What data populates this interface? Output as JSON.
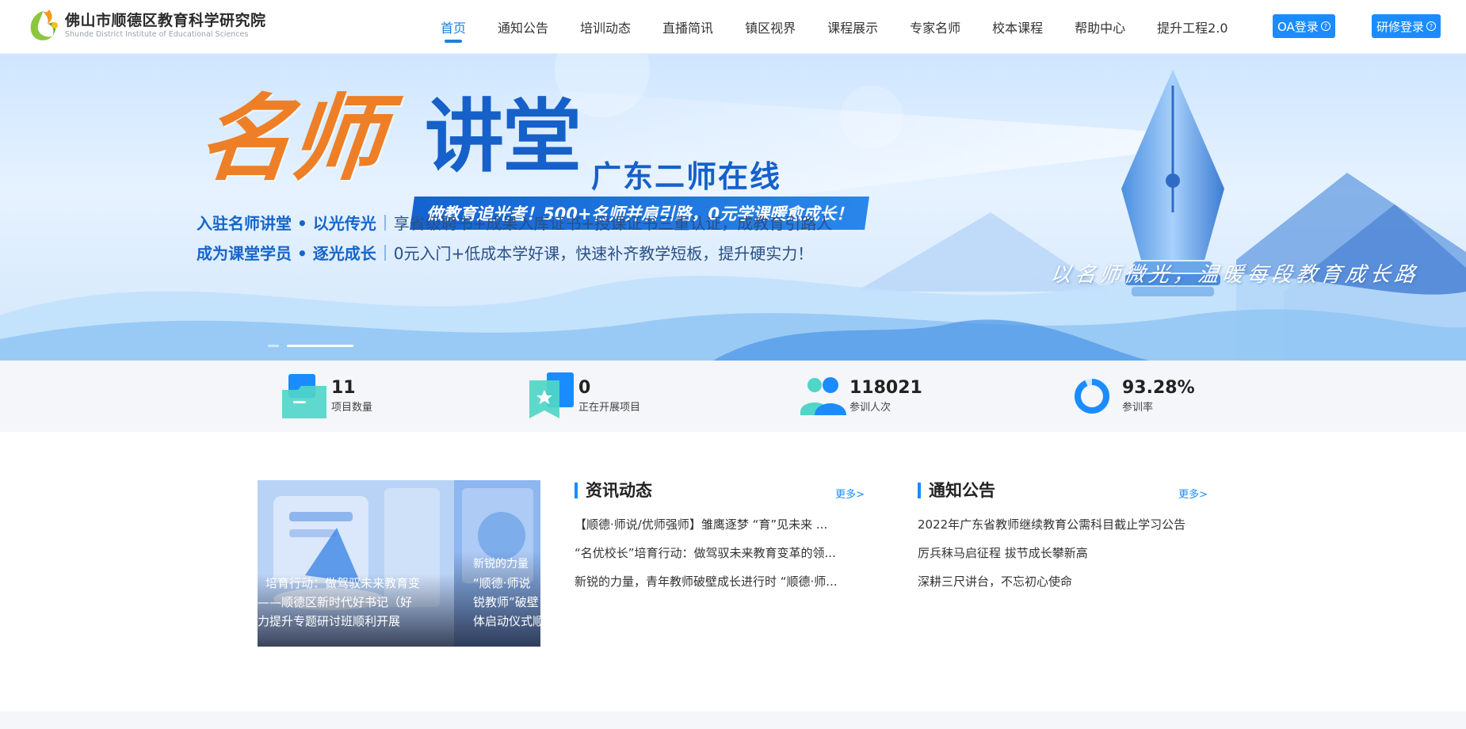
{
  "header": {
    "logo_cn": "佛山市顺德区教育科学研究院",
    "logo_en": "Shunde District Institute of Educational Sciences",
    "nav": [
      {
        "label": "首页",
        "active": true
      },
      {
        "label": "通知公告"
      },
      {
        "label": "培训动态"
      },
      {
        "label": "直播简讯"
      },
      {
        "label": "镇区视界"
      },
      {
        "label": "课程展示"
      },
      {
        "label": "专家名师"
      },
      {
        "label": "校本课程"
      },
      {
        "label": "帮助中心"
      },
      {
        "label": "提升工程2.0"
      }
    ],
    "oa_login": "OA登录",
    "study_login": "研修登录",
    "help_glyph": "?"
  },
  "banner": {
    "title_orange": "名师",
    "title_blue": "讲堂",
    "subtitle": "广东二师在线",
    "ribbon": "做教育追光者！500+名师并肩引路，0元学课暖愈成长！",
    "line1_key": "入驻名师讲堂 • 以光传光",
    "line1_value": "享省级聘书+成果入库证书+授课证书三重认证，成教育引路人",
    "line2_key": "成为课堂学员 • 逐光成长",
    "line2_value": "0元入门+低成本学好课，快速补齐教学短板，提升硬实力！",
    "slogan": "以名师微光，温暖每段教育成长路"
  },
  "stats": [
    {
      "value": "11",
      "label": "项目数量",
      "icon": "folder-icon"
    },
    {
      "value": "0",
      "label": "正在开展项目",
      "icon": "star-badge-icon"
    },
    {
      "value": "118021",
      "label": "参训人次",
      "icon": "users-icon"
    },
    {
      "value": "93.28%",
      "label": "参训率",
      "icon": "ring-chart-icon",
      "ratio": 0.9328
    }
  ],
  "carousel": {
    "slide1_lines": [
      "培育行动：做驾驭未来教育变",
      "——顺德区新时代好书记（好",
      "力提升专题研讨班顺利开展"
    ],
    "slide2_lines": [
      "新锐的力量",
      "“顺德·师说",
      "锐教师”破壁",
      "体启动仪式顺"
    ]
  },
  "news": {
    "title": "资讯动态",
    "more": "更多>",
    "items": [
      "【顺德·师说/优师强师】雏鹰逐梦 “育”见未来 ...",
      "“名优校长”培育行动：做驾驭未来教育变革的领...",
      "新锐的力量，青年教师破壁成长进行时 “顺德·师..."
    ]
  },
  "notice": {
    "title": "通知公告",
    "more": "更多>",
    "items": [
      "2022年广东省教师继续教育公需科目截止学习公告",
      "厉兵秣马启征程 拔节成长攀新高",
      "深耕三尺讲台，不忘初心使命"
    ]
  },
  "colors": {
    "primary": "#1a8cff",
    "orange": "#ee7f26",
    "navy": "#1660c9"
  }
}
